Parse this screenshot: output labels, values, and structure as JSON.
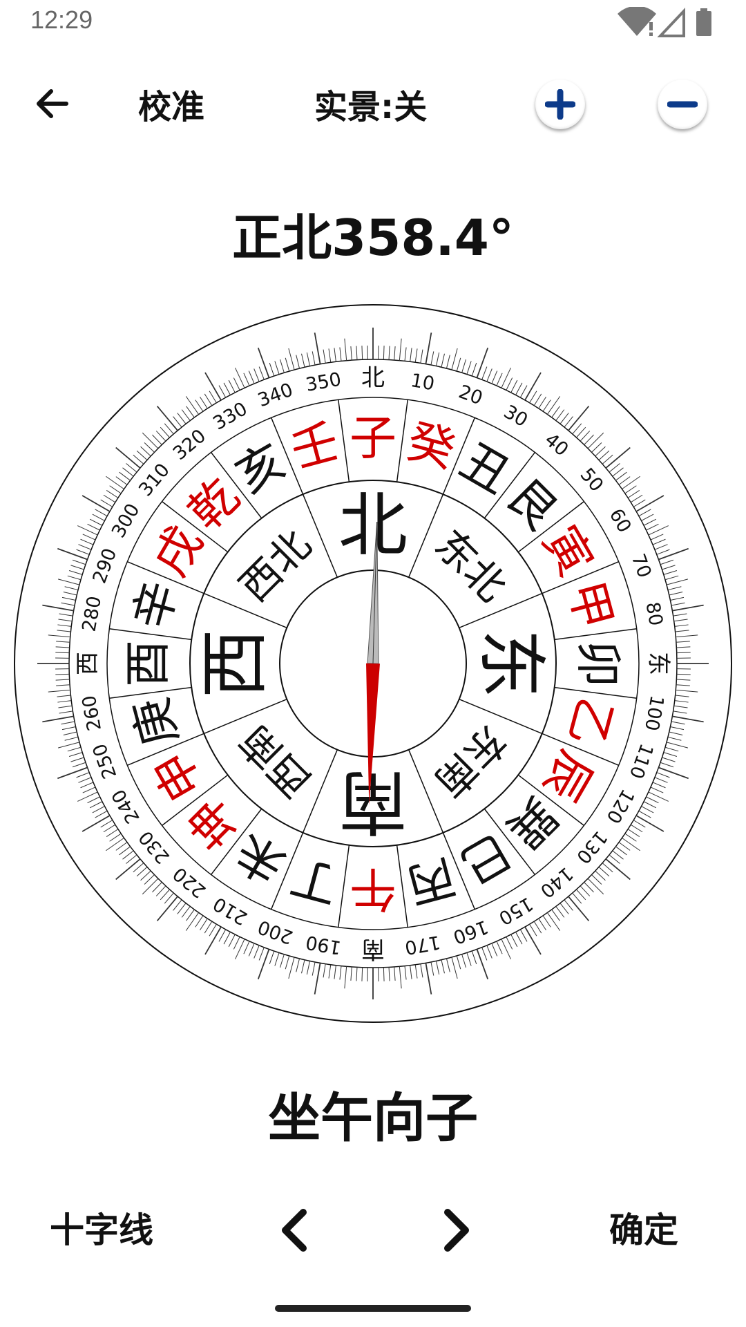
{
  "status_bar": {
    "time": "12:29",
    "icons": [
      "wifi-icon",
      "signal-icon",
      "battery-icon"
    ]
  },
  "toolbar": {
    "back_icon": "arrow-left-icon",
    "calibrate_label": "校准",
    "live_view_label": "实景:关",
    "zoom_in_icon": "plus-circle-icon",
    "zoom_out_icon": "minus-circle-icon",
    "zoom_icon_color": "#0d3b8a"
  },
  "heading_text": "正北358.4°",
  "compass": {
    "heading_degrees": 358.4,
    "needle_colors": {
      "north": "#bbbbbb",
      "south": "#cc0000"
    },
    "accent_red": "#d00000",
    "degree_labels": [
      "北",
      "10",
      "20",
      "30",
      "40",
      "50",
      "60",
      "70",
      "80",
      "东",
      "100",
      "110",
      "120",
      "130",
      "140",
      "150",
      "160",
      "170",
      "南",
      "190",
      "200",
      "210",
      "220",
      "230",
      "240",
      "250",
      "260",
      "西",
      "280",
      "290",
      "300",
      "310",
      "320",
      "330",
      "340",
      "350"
    ],
    "mountains": [
      {
        "label": "子",
        "red": true
      },
      {
        "label": "癸",
        "red": true
      },
      {
        "label": "丑",
        "red": false
      },
      {
        "label": "艮",
        "red": false
      },
      {
        "label": "寅",
        "red": true
      },
      {
        "label": "甲",
        "red": true
      },
      {
        "label": "卯",
        "red": false
      },
      {
        "label": "乙",
        "red": true
      },
      {
        "label": "辰",
        "red": true
      },
      {
        "label": "巽",
        "red": false
      },
      {
        "label": "巳",
        "red": false
      },
      {
        "label": "丙",
        "red": false
      },
      {
        "label": "午",
        "red": true
      },
      {
        "label": "丁",
        "red": false
      },
      {
        "label": "未",
        "red": false
      },
      {
        "label": "坤",
        "red": true
      },
      {
        "label": "申",
        "red": true
      },
      {
        "label": "庚",
        "red": false
      },
      {
        "label": "酉",
        "red": false
      },
      {
        "label": "辛",
        "red": false
      },
      {
        "label": "戌",
        "red": true
      },
      {
        "label": "乾",
        "red": true
      },
      {
        "label": "亥",
        "red": false
      },
      {
        "label": "壬",
        "red": true
      }
    ],
    "directions": [
      {
        "label": "北",
        "size": "large"
      },
      {
        "label": "东北",
        "size": "small"
      },
      {
        "label": "东",
        "size": "large"
      },
      {
        "label": "东南",
        "size": "small"
      },
      {
        "label": "南",
        "size": "large"
      },
      {
        "label": "西南",
        "size": "small"
      },
      {
        "label": "西",
        "size": "large"
      },
      {
        "label": "西北",
        "size": "small"
      }
    ]
  },
  "sitting_facing_text": "坐午向子",
  "bottom_bar": {
    "crosshair_label": "十字线",
    "prev_icon": "chevron-left-icon",
    "next_icon": "chevron-right-icon",
    "confirm_label": "确定"
  }
}
